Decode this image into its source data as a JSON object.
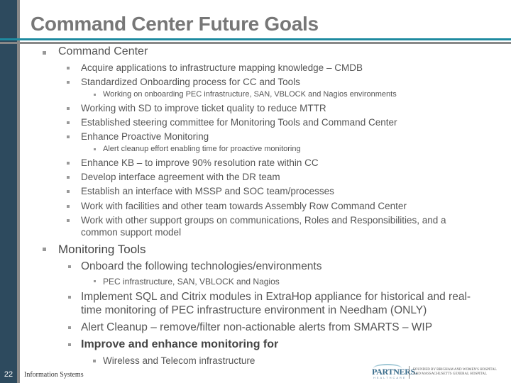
{
  "slide": {
    "title": "Command Center Future Goals",
    "page_number": "22",
    "footer": "Information Systems",
    "logo": {
      "name": "PARTNERS.",
      "sub": "HEALTHCARE",
      "text_line1": "FOUNDED BY BRIGHAM AND WOMEN'S HOSPITAL",
      "text_line2": "AND MASSACHUSETTS GENERAL HOSPITAL"
    },
    "colors": {
      "sidebar": "#2d4a5e",
      "accent_line": "#1e8aa0",
      "title": "#777777"
    }
  },
  "sections": [
    {
      "heading": "Command Center",
      "items": [
        {
          "text": "Acquire applications to infrastructure mapping knowledge – CMDB"
        },
        {
          "text": "Standardized Onboarding process for CC and Tools",
          "sub": [
            "Working on onboarding PEC infrastructure, SAN, VBLOCK and Nagios environments"
          ]
        },
        {
          "text": "Working with SD to improve ticket quality to reduce MTTR"
        },
        {
          "text": "Established steering committee for Monitoring Tools and Command Center"
        },
        {
          "text": "Enhance Proactive Monitoring",
          "sub": [
            "Alert cleanup effort enabling time for proactive monitoring"
          ]
        },
        {
          "text": "Enhance KB – to improve 90% resolution rate within CC"
        },
        {
          "text": "Develop interface agreement with the DR team"
        },
        {
          "text": "Establish an interface with MSSP and SOC team/processes"
        },
        {
          "text": "Work with facilities and other team towards Assembly Row Command Center"
        },
        {
          "text_line1": "Work with other support groups on communications, Roles and Responsibilities, and a",
          "text_line2": "common support model"
        }
      ]
    },
    {
      "heading": "Monitoring Tools",
      "items": [
        {
          "text": "Onboard the following technologies/environments",
          "sub": [
            "PEC infrastructure, SAN, VBLOCK and Nagios"
          ]
        },
        {
          "text_line1": "Implement SQL and Citrix modules in ExtraHop appliance for historical and real-",
          "text_line2": "time monitoring of PEC infrastructure environment in Needham (ONLY)"
        },
        {
          "text": "Alert Cleanup – remove/filter non-actionable alerts from SMARTS – WIP"
        },
        {
          "text": "Improve and enhance monitoring for",
          "sub": [
            "Wireless and Telecom infrastructure"
          ]
        }
      ]
    }
  ]
}
